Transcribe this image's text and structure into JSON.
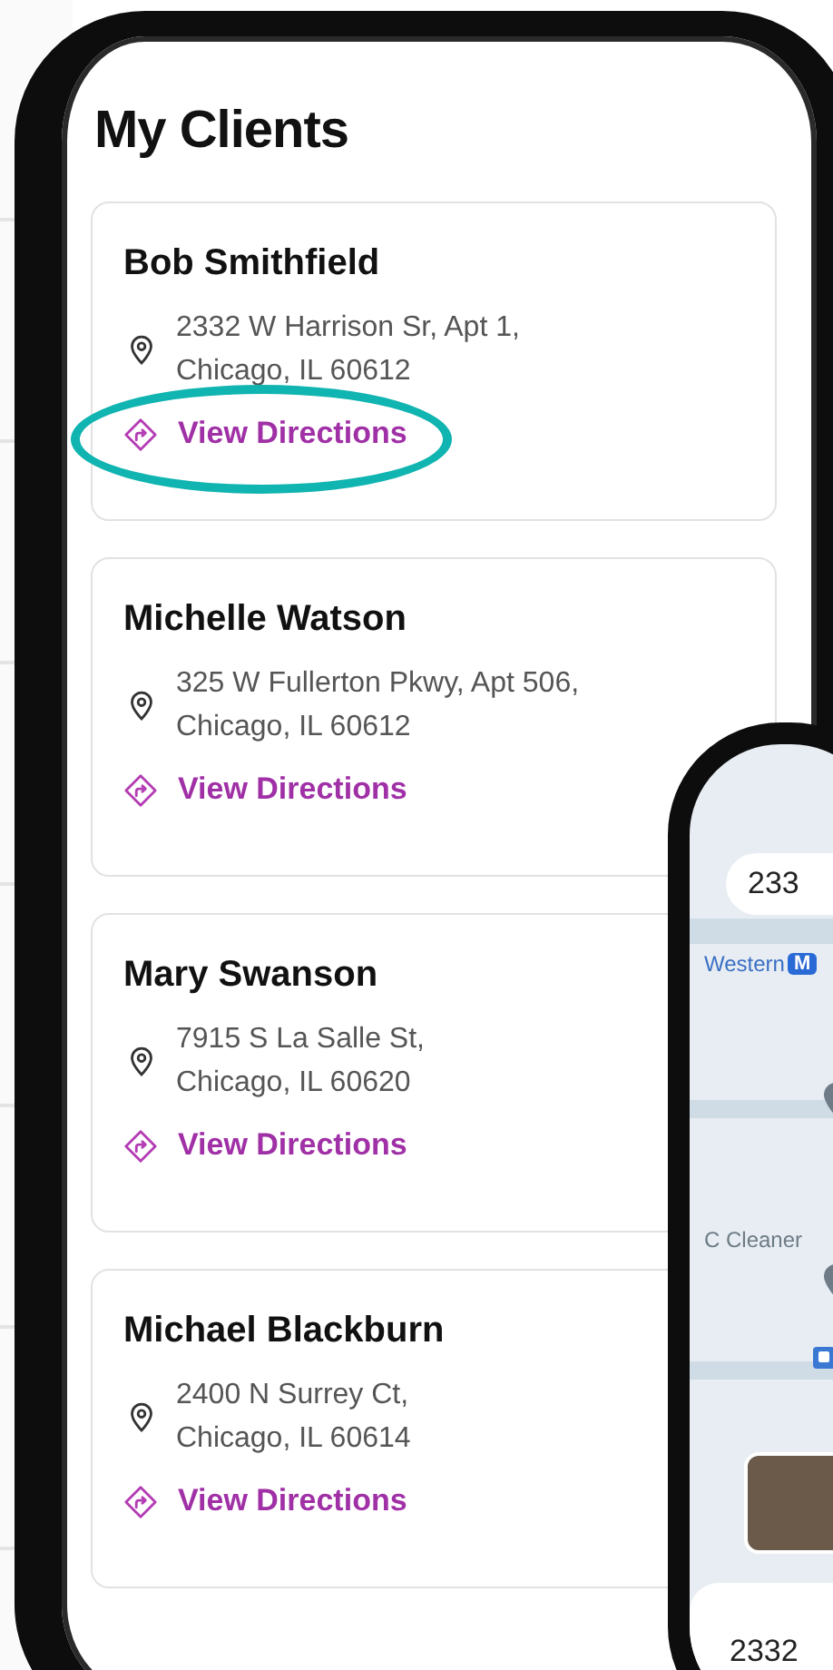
{
  "screen": {
    "title": "My Clients"
  },
  "clients": [
    {
      "name": "Bob Smithfield",
      "address": [
        "2332 W Harrison Sr, Apt 1,",
        "Chicago, IL 60612"
      ],
      "link": "View Directions",
      "highlighted": true
    },
    {
      "name": "Michelle Watson",
      "address": [
        "325 W Fullerton Pkwy, Apt 506,",
        "Chicago, IL 60612"
      ],
      "link": "View Directions",
      "highlighted": false
    },
    {
      "name": "Mary Swanson",
      "address": [
        "7915 S La Salle St,",
        "Chicago, IL 60620"
      ],
      "link": "View Directions",
      "highlighted": false
    },
    {
      "name": "Michael Blackburn",
      "address": [
        "2400 N Surrey Ct,",
        "Chicago, IL 60614"
      ],
      "link": "View Directions",
      "highlighted": false
    }
  ],
  "map_phone": {
    "search_value": "233",
    "station_label": "Western",
    "station_badge": "M",
    "place_label": "C Cleaner",
    "address_preview": "2332"
  }
}
